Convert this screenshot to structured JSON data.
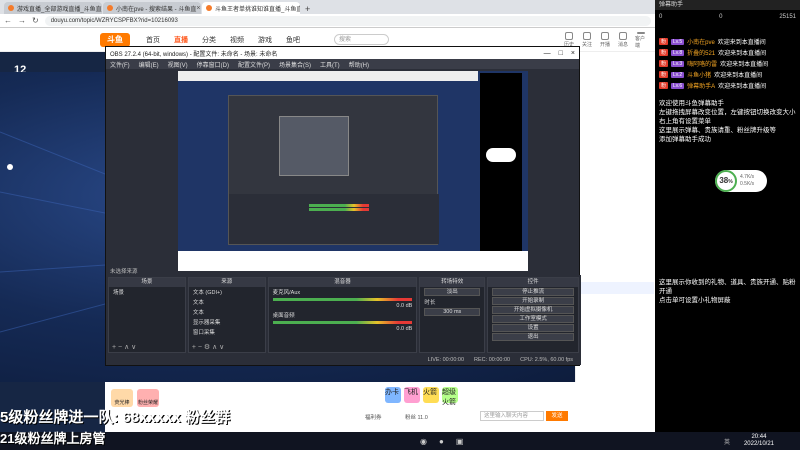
{
  "browser": {
    "tabs": [
      {
        "label": "游戏直播_全部游戏直播_斗鱼直",
        "active": false
      },
      {
        "label": "小南在pve - 搜索结果 - 斗鱼直",
        "active": false
      },
      {
        "label": "斗鱼王者单挑谁知谁直播_斗鱼直",
        "active": true
      }
    ],
    "url": "douyu.com/topic/WZRYCSPFBX?rid=10216093"
  },
  "site": {
    "logo": "斗鱼",
    "nav": [
      "首页",
      "直播",
      "分类",
      "视频",
      "游戏",
      "鱼吧"
    ],
    "active_nav": "直播",
    "search_placeholder": "搜索",
    "header_icons": [
      "历史",
      "关注",
      "开播",
      "消息",
      "客户端"
    ],
    "left_number": "12",
    "gift_items": [
      "荧光棒",
      "粉丝荣耀",
      "办卡",
      "飞机",
      "火箭",
      "超级火箭"
    ],
    "fan_label": "粉丝 11.0",
    "room_label": "福利券",
    "chat_placeholder": "这里输入聊天内容",
    "send_label": "发送"
  },
  "obs": {
    "title": "OBS 27.2.4 (64-bit, windows) - 配置文件: 未命名 - 场景: 未命名",
    "menu": [
      "文件(F)",
      "编辑(E)",
      "视图(V)",
      "停靠窗口(D)",
      "配置文件(P)",
      "场景集合(S)",
      "工具(T)",
      "帮助(H)"
    ],
    "scenes_title": "场景",
    "scenes": [
      "场景"
    ],
    "sources_title": "来源",
    "sources": [
      "文本 (GDI+)",
      "文本",
      "文本",
      "显示器采集",
      "窗口采集"
    ],
    "mixer_title": "混音器",
    "mixer": [
      {
        "name": "麦克风/Aux",
        "db": "0.0 dB"
      },
      {
        "name": "桌面音频",
        "db": "0.0 dB"
      }
    ],
    "transition_title": "转场特效",
    "transition_type": "淡出",
    "duration_label": "时长",
    "duration": "300 ms",
    "controls_title": "控件",
    "controls": [
      "停止推流",
      "开始录制",
      "开始虚拟摄像机",
      "工作室模式",
      "设置",
      "退出"
    ],
    "no_source": "未选择来源",
    "status": [
      "LIVE: 00:00:00",
      "REC: 00:00:00",
      "CPU: 2.5%, 60.00 fps"
    ]
  },
  "overlay": {
    "lines": [
      "5级粉丝牌进一队: 68xxxxx 粉丝群",
      "21级粉丝牌上房管"
    ]
  },
  "chatpanel": {
    "title": "弹幕助手",
    "stats": [
      "0",
      "0",
      "25151"
    ],
    "messages": [
      {
        "badge": "粉",
        "level": "Lv.5",
        "nick": "小南在pve",
        "text": "欢迎来到本直播间"
      },
      {
        "badge": "粉",
        "level": "Lv.8",
        "nick": "折叠的521",
        "text": "欢迎来到本直播间"
      },
      {
        "badge": "粉",
        "level": "Lv.3",
        "nick": "嗨阿咯的雷",
        "text": "欢迎来到本直播间"
      },
      {
        "badge": "粉",
        "level": "Lv.2",
        "nick": "斗鱼小猪",
        "text": "欢迎来到本直播间"
      },
      {
        "badge": "粉",
        "level": "Lv.6",
        "nick": "弹幕助手A",
        "text": "欢迎来到本直播间"
      }
    ],
    "notice1": "欢迎使用斗鱼弹幕助手\n左键拖拽屏幕改变位置，左键按钮切换改变大小\n右上角有设置菜单\n这里展示弹幕、贵族请重、粉丝牌升级等\n添加弹幕助手成功",
    "cpu": {
      "value": "38",
      "unit": "%",
      "up": "4.7K/s",
      "down": "0.5K/s"
    },
    "notice2": "这里展示你收到的礼物、道具、贵族开通、贴粉开通\n点击单可设置小礼物屏蔽"
  },
  "taskbar": {
    "time": "20:44",
    "date": "2022/10/21",
    "sys": "英"
  }
}
